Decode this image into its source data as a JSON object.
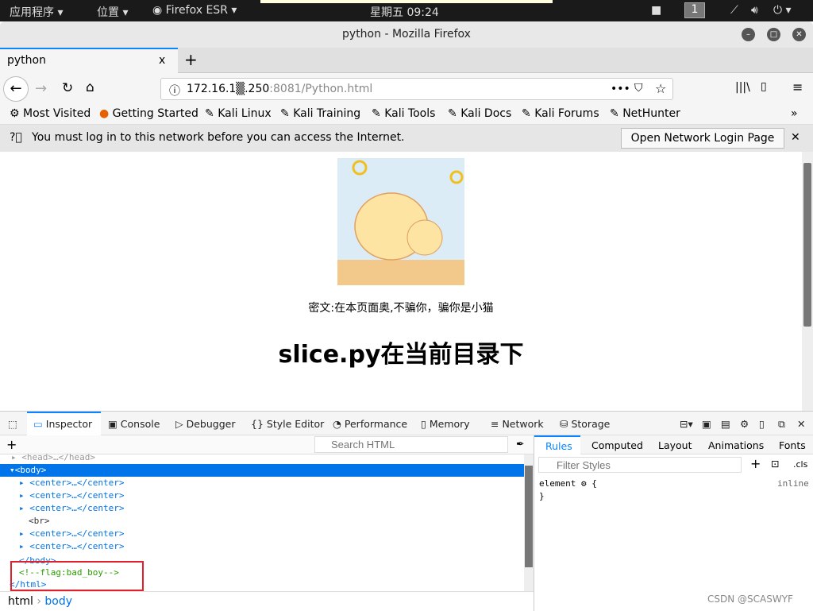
{
  "topbar": {
    "apps": "应用程序 ▾",
    "places": "位置 ▾",
    "app": "Firefox ESR ▾",
    "clock": "星期五 09:24",
    "workspace": "1"
  },
  "window": {
    "title": "python - Mozilla Firefox"
  },
  "tab": {
    "label": "python",
    "close": "x",
    "new": "+"
  },
  "nav": {
    "url_host": "172.16.1▒.250",
    "url_rest": ":8081/Python.html",
    "more": "•••"
  },
  "bookmarks": [
    "Most Visited",
    "Getting Started",
    "Kali Linux",
    "Kali Training",
    "Kali Tools",
    "Kali Docs",
    "Kali Forums",
    "NetHunter"
  ],
  "notice": {
    "text": "You must log in to this network before you can access the Internet.",
    "button": "Open Network Login Page",
    "close": "✕"
  },
  "page": {
    "cipher": "密文:在本页面奥,不骗你，骗你是小猫",
    "heading": "slice.py在当前目录下"
  },
  "devtools": {
    "tabs": [
      "Inspector",
      "Console",
      "Debugger",
      "Style Editor",
      "Performance",
      "Memory",
      "Network",
      "Storage"
    ],
    "search_placeholder": "Search HTML",
    "tree": {
      "head": "<head>…</head>",
      "body": "<body>",
      "center": "<center>…</center>",
      "br": "<br>",
      "body_close": "</body>",
      "comment": "<!--flag:bad_boy-->",
      "html_close": "</html>"
    },
    "breadcrumb": [
      "html",
      "body"
    ],
    "side_tabs": [
      "Rules",
      "Computed",
      "Layout",
      "Animations",
      "Fonts"
    ],
    "filter_placeholder": "Filter Styles",
    "cls": ".cls",
    "rule_selector": "element ⚙ {",
    "rule_close": "}",
    "rule_source": "inline"
  },
  "watermark": "CSDN @SCASWYF",
  "colors": {
    "accent": "#0a84ff",
    "selected": "#0074e8",
    "comment": "#2a9d00",
    "highlight_box": "#e0202a"
  }
}
